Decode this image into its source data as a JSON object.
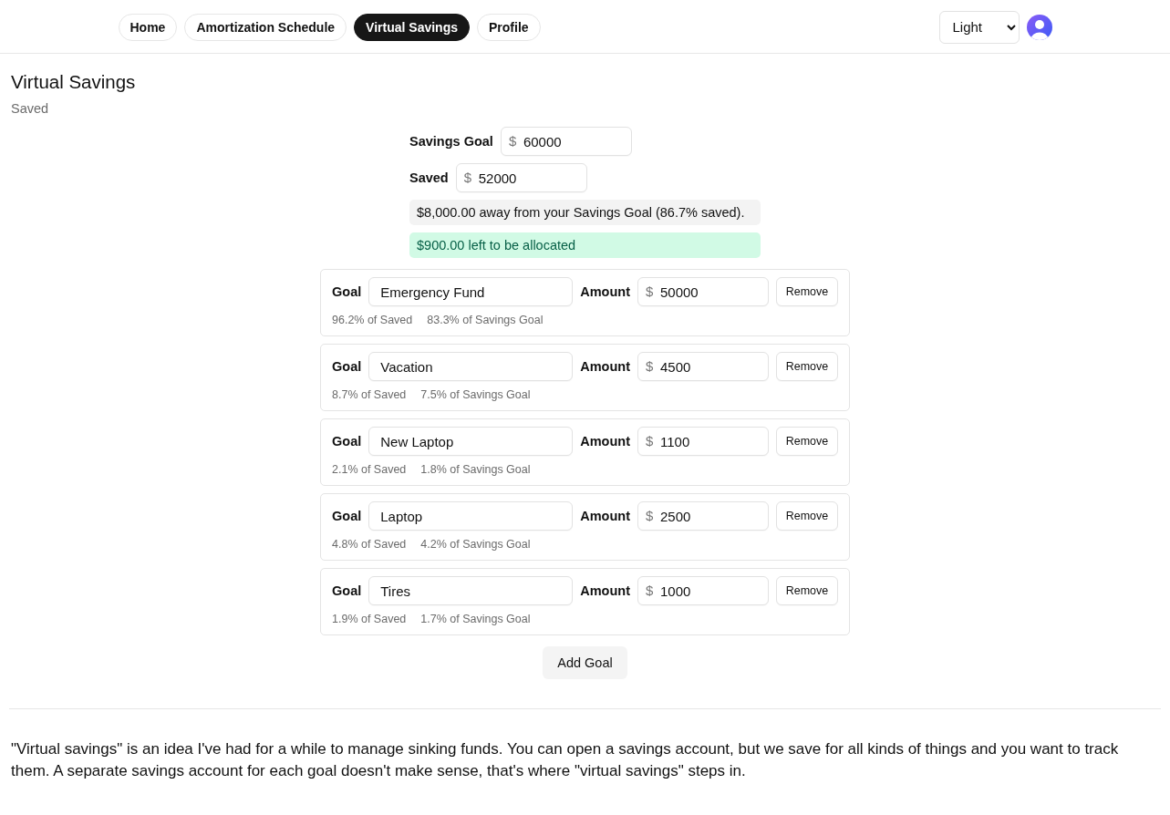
{
  "header": {
    "tabs": [
      {
        "label": "Home",
        "selected": false
      },
      {
        "label": "Amortization Schedule",
        "selected": false
      },
      {
        "label": "Virtual Savings",
        "selected": true
      },
      {
        "label": "Profile",
        "selected": false
      }
    ],
    "theme_select": {
      "value": "Light"
    }
  },
  "page": {
    "title": "Virtual Savings",
    "subtitle": "Saved"
  },
  "totals": [
    {
      "label": "Savings Goal",
      "currency": "$",
      "value": "60000"
    },
    {
      "label": "Saved",
      "currency": "$",
      "value": "52000"
    }
  ],
  "notices": [
    {
      "kind": "info",
      "text": "$8,000.00 away from your Savings Goal (86.7% saved)."
    },
    {
      "kind": "success",
      "text": "$900.00 left to be allocated"
    }
  ],
  "goals": [
    {
      "goal_label": "Goal",
      "name": "Emergency Fund",
      "amount_label": "Amount",
      "currency": "$",
      "amount": "50000",
      "remove": "Remove",
      "share_of_saved": "96.2% of Saved",
      "share_of_goal": "83.3% of Savings Goal"
    },
    {
      "goal_label": "Goal",
      "name": "Vacation",
      "amount_label": "Amount",
      "currency": "$",
      "amount": "4500",
      "remove": "Remove",
      "share_of_saved": "8.7% of Saved",
      "share_of_goal": "7.5% of Savings Goal"
    },
    {
      "goal_label": "Goal",
      "name": "New Laptop",
      "amount_label": "Amount",
      "currency": "$",
      "amount": "1100",
      "remove": "Remove",
      "share_of_saved": "2.1% of Saved",
      "share_of_goal": "1.8% of Savings Goal"
    },
    {
      "goal_label": "Goal",
      "name": "Laptop",
      "amount_label": "Amount",
      "currency": "$",
      "amount": "2500",
      "remove": "Remove",
      "share_of_saved": "4.8% of Saved",
      "share_of_goal": "4.2% of Savings Goal"
    },
    {
      "goal_label": "Goal",
      "name": "Tires",
      "amount_label": "Amount",
      "currency": "$",
      "amount": "1000",
      "remove": "Remove",
      "share_of_saved": "1.9% of Saved",
      "share_of_goal": "1.7% of Savings Goal"
    }
  ],
  "add_button": "Add Goal",
  "description": "\"Virtual savings\" is an idea I've had for a while to manage sinking funds. You can open a savings account, but we save for all kinds of things and you want to track them. A separate savings account for each goal doesn't make sense, that's where \"virtual savings\" steps in."
}
